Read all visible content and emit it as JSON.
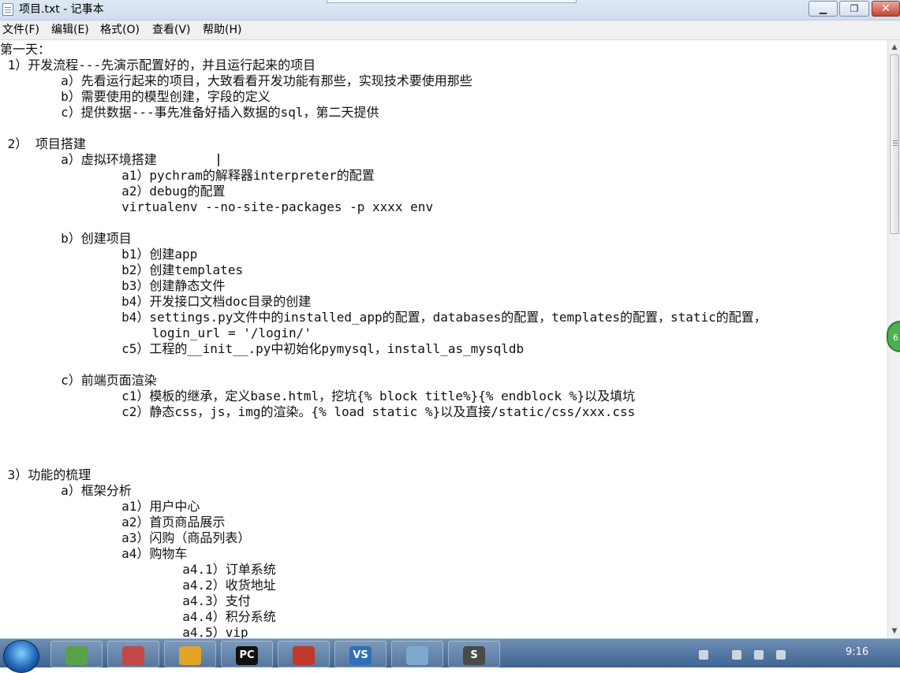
{
  "window": {
    "title": "项目.txt - 记事本",
    "minimize_glyph": "▁",
    "maximize_glyph": "❐",
    "close_glyph": "✕"
  },
  "menu": [
    "文件(F)",
    "编辑(E)",
    "格式(O)",
    "查看(V)",
    "帮助(H)"
  ],
  "editor": {
    "lines": [
      "第一天：",
      " 1）开发流程---先演示配置好的，并且运行起来的项目",
      "        a）先看运行起来的项目，大致看看开发功能有那些，实现技术要使用那些",
      "        b）需要使用的模型创建，字段的定义",
      "        c）提供数据---事先准备好插入数据的sql，第二天提供",
      "",
      " 2） 项目搭建",
      "        a）虚拟环境搭建",
      "                a1）pychram的解释器interpreter的配置",
      "                a2）debug的配置",
      "                virtualenv --no-site-packages -p xxxx env",
      "",
      "        b）创建项目",
      "                b1）创建app",
      "                b2）创建templates",
      "                b3）创建静态文件",
      "                b4）开发接口文档doc目录的创建",
      "                b4）settings.py文件中的installed_app的配置，databases的配置，templates的配置，static的配置，",
      "                    login_url = '/login/'",
      "                c5）工程的__init__.py中初始化pymysql，install_as_mysqldb",
      "",
      "        c）前端页面渲染",
      "                c1）模板的继承，定义base.html，挖坑{% block title%}{% endblock %}以及填坑",
      "                c2）静态css，js，img的渲染。{% load static %}以及直接/static/css/xxx.css",
      "",
      "",
      "",
      " 3）功能的梳理",
      "        a）框架分析",
      "                a1）用户中心",
      "                a2）首页商品展示",
      "                a3）闪购（商品列表）",
      "                a4）购物车",
      "                        a4.1）订单系统",
      "                        a4.2）收货地址",
      "                        a4.3）支付",
      "                        a4.4）积分系统",
      "                        a4.5）vip"
    ]
  },
  "float_badge": "6",
  "taskbar": {
    "apps": [
      {
        "name": "users-icon",
        "glyph": "",
        "color": "#58a34a"
      },
      {
        "name": "puzzle-icon",
        "glyph": "",
        "color": "#c24848"
      },
      {
        "name": "chrome-icon",
        "glyph": "",
        "color": "#e0a526"
      },
      {
        "name": "pycharm-icon",
        "glyph": "PC",
        "color": "#111111"
      },
      {
        "name": "ninja-icon",
        "glyph": "",
        "color": "#c0392b"
      },
      {
        "name": "vs-icon",
        "glyph": "VS",
        "color": "#2f6fb5"
      },
      {
        "name": "notepad-icon",
        "glyph": "",
        "color": "#7fa8cf"
      },
      {
        "name": "sublime-icon",
        "glyph": "S",
        "color": "#4a4a4a"
      }
    ],
    "clock": "9:16"
  }
}
